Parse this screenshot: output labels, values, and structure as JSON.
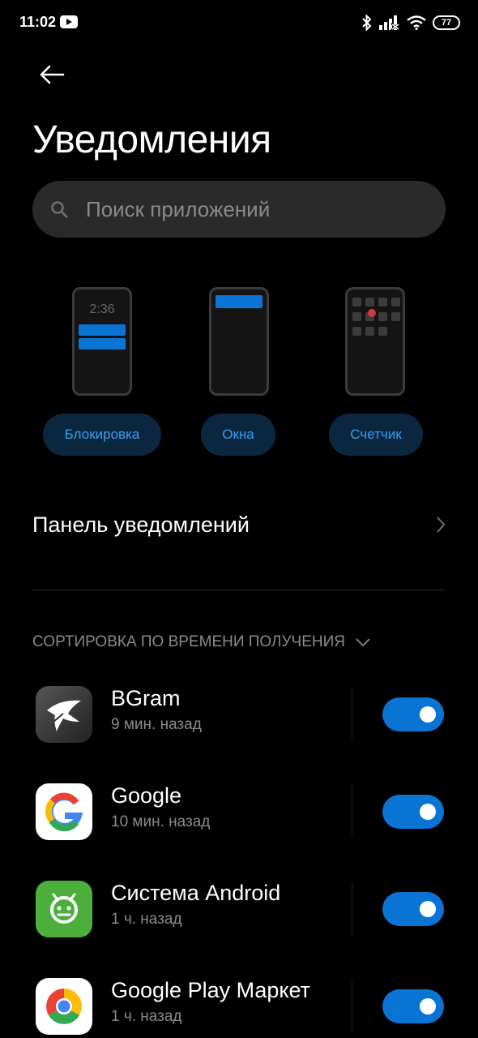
{
  "status_bar": {
    "time": "11:02",
    "battery": "77",
    "icons": [
      "youtube-icon",
      "bluetooth-icon",
      "signal-icon",
      "wifi-icon",
      "battery-icon"
    ]
  },
  "header": {
    "back_icon": "arrow-left-icon",
    "title": "Уведомления"
  },
  "search": {
    "placeholder": "Поиск приложений",
    "icon": "search-icon"
  },
  "notification_styles": {
    "lockscreen": {
      "label": "Блокировка",
      "clock": "2:36"
    },
    "windows": {
      "label": "Окна"
    },
    "counter": {
      "label": "Счетчик"
    }
  },
  "notification_panel": {
    "label": "Панель уведомлений",
    "icon": "chevron-right-icon"
  },
  "sort": {
    "label": "СОРТИРОВКА ПО ВРЕМЕНИ ПОЛУЧЕНИЯ",
    "icon": "chevron-down-icon"
  },
  "apps": [
    {
      "name": "BGram",
      "time": "9 мин. назад",
      "enabled": true,
      "icon": "bgram-icon"
    },
    {
      "name": "Google",
      "time": "10 мин. назад",
      "enabled": true,
      "icon": "google-icon"
    },
    {
      "name": "Система Android",
      "time": "1 ч. назад",
      "enabled": true,
      "icon": "android-system-icon"
    },
    {
      "name": "Google Play Маркет",
      "time": "1 ч. назад",
      "enabled": true,
      "icon": "chrome-icon"
    }
  ],
  "colors": {
    "background": "#000000",
    "accent": "#0a74d4",
    "pill_bg": "#0b2740",
    "pill_text": "#3a9bf0",
    "secondary_text": "#8a8a8a",
    "search_bg": "#2a2a2a"
  }
}
